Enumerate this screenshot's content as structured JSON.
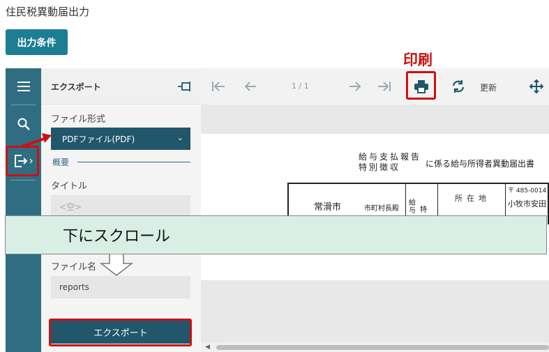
{
  "page": {
    "title": "住民税異動届出力",
    "condition_button": "出力条件"
  },
  "panel": {
    "title": "エクスポート",
    "format_label": "ファイル形式",
    "format_value": "PDFファイル(PDF)",
    "section_label": "概要",
    "title_label": "タイトル",
    "title_placeholder": "<空>",
    "filename_label": "ファイル名",
    "filename_value": "reports",
    "export_button": "エクスポート"
  },
  "toolbar": {
    "page_info": "1 / 1",
    "refresh_label": "更新"
  },
  "annotations": {
    "print_callout": "印刷",
    "scroll_banner": "下にスクロール",
    "highlight_color": "#cc1111"
  },
  "document": {
    "heading_line1": "給与支払報告",
    "heading_line2": "特別徴収",
    "heading_suffix": "に係る給与所得者異動届出書",
    "city": "常滑市",
    "mayor": "市町村長殿",
    "kyu": "給与",
    "toku": "特",
    "location_label": "所在地",
    "zip": "〒 485-0014",
    "address": "小牧市安田"
  },
  "colors": {
    "accent": "#1c7d93",
    "sidebar": "#2f6e82",
    "dark_button": "#21566b"
  },
  "icons": [
    "menu-icon",
    "search-icon",
    "export-icon",
    "pin-icon",
    "first-page-icon",
    "prev-page-icon",
    "next-page-icon",
    "last-page-icon",
    "print-icon",
    "refresh-icon",
    "move-icon"
  ]
}
